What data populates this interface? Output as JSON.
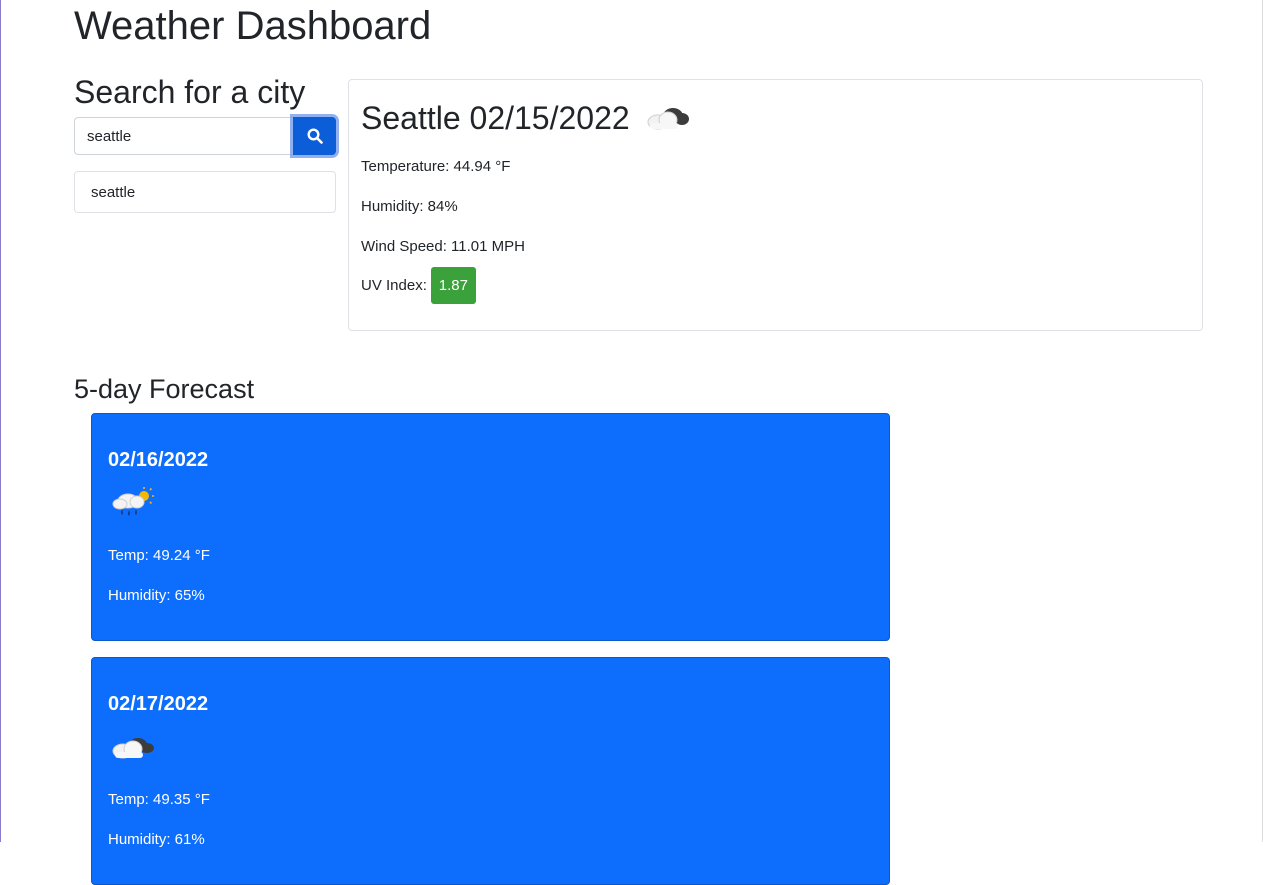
{
  "page": {
    "title": "Weather Dashboard"
  },
  "search": {
    "heading": "Search for a city",
    "value": "seattle",
    "button_icon": "search-icon",
    "history": [
      "seattle"
    ]
  },
  "current": {
    "title": "Seattle 02/15/2022",
    "icon": "cloud-icon",
    "temperature": "Temperature: 44.94 °F",
    "humidity": "Humidity: 84%",
    "wind": "Wind Speed: 11.01 MPH",
    "uv_label": "UV Index:",
    "uv_value": "1.87",
    "uv_color": "#3ba13a"
  },
  "forecast": {
    "heading": "5-day Forecast",
    "accent": "#0d6efd",
    "days": [
      {
        "date": "02/16/2022",
        "icon": "rain-sun-icon",
        "temp": "Temp: 49.24 °F",
        "humidity": "Humidity: 65%"
      },
      {
        "date": "02/17/2022",
        "icon": "cloud-icon",
        "temp": "Temp: 49.35 °F",
        "humidity": "Humidity: 61%"
      }
    ]
  }
}
